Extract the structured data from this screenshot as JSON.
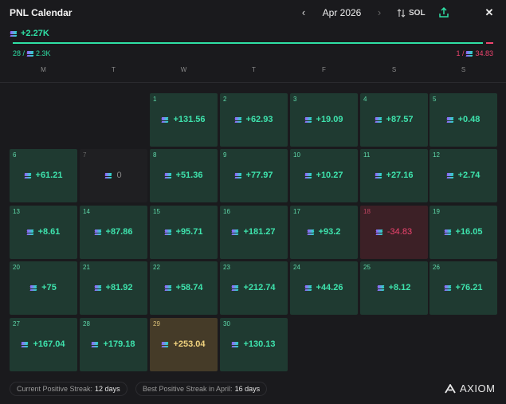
{
  "header": {
    "title": "PNL Calendar",
    "month": "Apr 2026",
    "currency": "SOL"
  },
  "summary": {
    "total": "+2.27K",
    "positive_days": "28 /",
    "positive_amount": "2.3K",
    "negative_days": "1 /",
    "negative_amount": "34.83",
    "positive_share": 0.985
  },
  "weekdays": [
    "M",
    "T",
    "W",
    "T",
    "F",
    "S",
    "S"
  ],
  "days": [
    {
      "day": "1",
      "value": "+131.56",
      "kind": "pos"
    },
    {
      "day": "2",
      "value": "+62.93",
      "kind": "pos"
    },
    {
      "day": "3",
      "value": "+19.09",
      "kind": "pos"
    },
    {
      "day": "4",
      "value": "+87.57",
      "kind": "pos"
    },
    {
      "day": "5",
      "value": "+0.48",
      "kind": "pos"
    },
    {
      "day": "6",
      "value": "+61.21",
      "kind": "pos"
    },
    {
      "day": "7",
      "value": "0",
      "kind": "zero"
    },
    {
      "day": "8",
      "value": "+51.36",
      "kind": "pos"
    },
    {
      "day": "9",
      "value": "+77.97",
      "kind": "pos"
    },
    {
      "day": "10",
      "value": "+10.27",
      "kind": "pos"
    },
    {
      "day": "11",
      "value": "+27.16",
      "kind": "pos"
    },
    {
      "day": "12",
      "value": "+2.74",
      "kind": "pos"
    },
    {
      "day": "13",
      "value": "+8.61",
      "kind": "pos"
    },
    {
      "day": "14",
      "value": "+87.86",
      "kind": "pos"
    },
    {
      "day": "15",
      "value": "+95.71",
      "kind": "pos"
    },
    {
      "day": "16",
      "value": "+181.27",
      "kind": "pos"
    },
    {
      "day": "17",
      "value": "+93.2",
      "kind": "pos"
    },
    {
      "day": "18",
      "value": "-34.83",
      "kind": "neg"
    },
    {
      "day": "19",
      "value": "+16.05",
      "kind": "pos"
    },
    {
      "day": "20",
      "value": "+75",
      "kind": "pos"
    },
    {
      "day": "21",
      "value": "+81.92",
      "kind": "pos"
    },
    {
      "day": "22",
      "value": "+58.74",
      "kind": "pos"
    },
    {
      "day": "23",
      "value": "+212.74",
      "kind": "pos"
    },
    {
      "day": "24",
      "value": "+44.26",
      "kind": "pos"
    },
    {
      "day": "25",
      "value": "+8.12",
      "kind": "pos"
    },
    {
      "day": "26",
      "value": "+76.21",
      "kind": "pos"
    },
    {
      "day": "27",
      "value": "+167.04",
      "kind": "pos"
    },
    {
      "day": "28",
      "value": "+179.18",
      "kind": "pos"
    },
    {
      "day": "29",
      "value": "+253.04",
      "kind": "best"
    },
    {
      "day": "30",
      "value": "+130.13",
      "kind": "pos"
    }
  ],
  "streaks": {
    "current_label": "Current Positive Streak:",
    "current_value": "12 days",
    "best_label": "Best Positive Streak in April:",
    "best_value": "16 days"
  },
  "brand": "AXIOM",
  "colors": {
    "positive": "#2fe0a5",
    "negative": "#f0446f",
    "best": "#f0d27e"
  },
  "icons": {
    "prev": "chevron-left-icon",
    "next": "chevron-right-icon",
    "currency": "sort-arrows-icon",
    "share": "share-upload-icon",
    "close": "close-icon",
    "coin": "solana-icon",
    "brand": "axiom-logo-icon"
  }
}
